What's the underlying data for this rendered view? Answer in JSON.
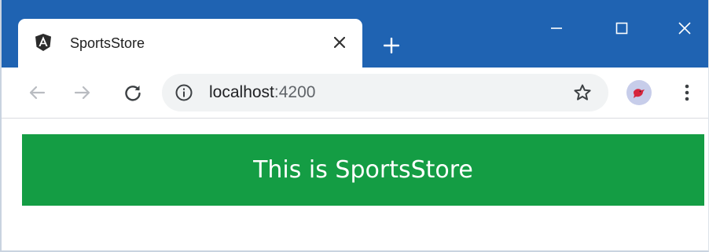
{
  "browser": {
    "tab": {
      "title": "SportsStore",
      "favicon": "angular-logo-icon"
    },
    "window_controls": [
      "minimize-icon",
      "maximize-icon",
      "close-icon"
    ],
    "address_bar": {
      "host": "localhost",
      "port": ":4200"
    },
    "toolbar_icons": [
      "back-arrow-icon",
      "forward-arrow-icon",
      "reload-icon",
      "info-icon",
      "star-icon",
      "avatar",
      "more-vert-icon"
    ],
    "colors": {
      "titlebar": "#1f63b2",
      "omnibox": "#f1f3f4"
    }
  },
  "page": {
    "banner_text": "This is SportsStore",
    "banner_color": "#149d44"
  }
}
